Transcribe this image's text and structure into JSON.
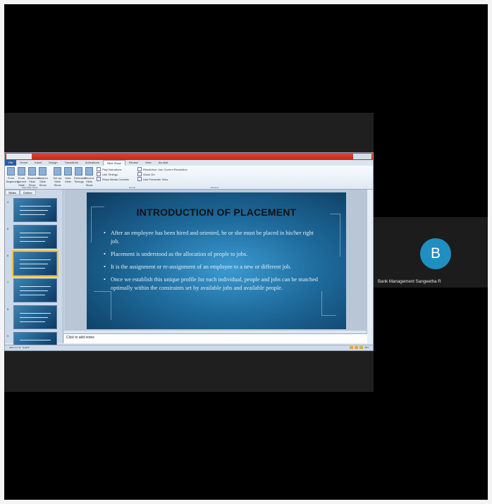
{
  "window": {
    "title_text": ""
  },
  "ribbon": {
    "tabs": [
      "File",
      "Home",
      "Insert",
      "Design",
      "Transitions",
      "Animations",
      "Slide Show",
      "Review",
      "View",
      "Acrobat"
    ],
    "active_tab": "Slide Show",
    "start_group": {
      "buttons": [
        "From Beginning",
        "From Current Slide",
        "Broadcast Slide Show",
        "Custom Slide Show"
      ],
      "label": "Start Slide Show"
    },
    "setup_group": {
      "buttons": [
        "Set Up Slide Show",
        "Hide Slide",
        "Rehearse Timings",
        "Record Slide Show"
      ],
      "checkboxes": [
        "Play Narrations",
        "Use Timings",
        "Show Media Controls"
      ],
      "label": "Set Up"
    },
    "monitors_group": {
      "items": [
        "Resolution: Use Current Resolution",
        "Show On:",
        "Use Presenter View"
      ],
      "label": "Monitors"
    }
  },
  "left_pane": {
    "tabs": [
      "Slides",
      "Outline"
    ],
    "thumb_numbers": [
      "4",
      "5",
      "6",
      "7",
      "8",
      "9"
    ]
  },
  "slide": {
    "title": "INTRODUCTION OF PLACEMENT",
    "bullets": [
      "After an employee has been hired and oriented, he or she must be placed in his/her right job.",
      "Placement is understood as the allocation of people to jobs.",
      "It is the assignment or re-assignment of an employee to a new or different job.",
      "Once we establish this unique profile for each individual, people and jobs can be matched optimally within the constraints set by available jobs and available people."
    ]
  },
  "notes": {
    "placeholder": "Click to add notes"
  },
  "status_bar": {
    "left": "Slide 6 of 12",
    "language": "English",
    "zoom": "78%"
  },
  "participant": {
    "initial": "B",
    "name": "Bank Management Sangeetha R",
    "avatar_color": "#1f8fc1"
  }
}
